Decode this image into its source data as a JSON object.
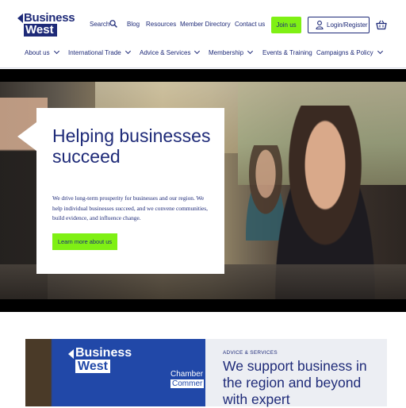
{
  "brand": {
    "line1": "Business",
    "line2": "West",
    "accent": "#1e2a78",
    "green": "#7ff014"
  },
  "topnav": {
    "search": "Search",
    "blog": "Blog",
    "resources": "Resources",
    "member_directory": "Member Directory",
    "contact": "Contact us",
    "join": "Join us",
    "login": "Login/Register"
  },
  "mainnav": [
    "About us",
    "International Trade",
    "Advice & Services",
    "Membership",
    "Events & Training",
    "Campaigns & Policy"
  ],
  "hero": {
    "title": "Helping businesses succeed",
    "text": "We drive long-term prosperity for businesses and our region. We help individual businesses succeed, and we convene communities, build evidence, and influence change.",
    "button": "Learn more about us"
  },
  "lower": {
    "photo_logo_line1": "Business",
    "photo_logo_line2": "West",
    "photo_chamber_line1": "Chamber",
    "photo_chamber_line2": "Commer",
    "eyebrow": "ADVICE & SERVICES",
    "title": "We support business in the region and beyond with expert"
  }
}
